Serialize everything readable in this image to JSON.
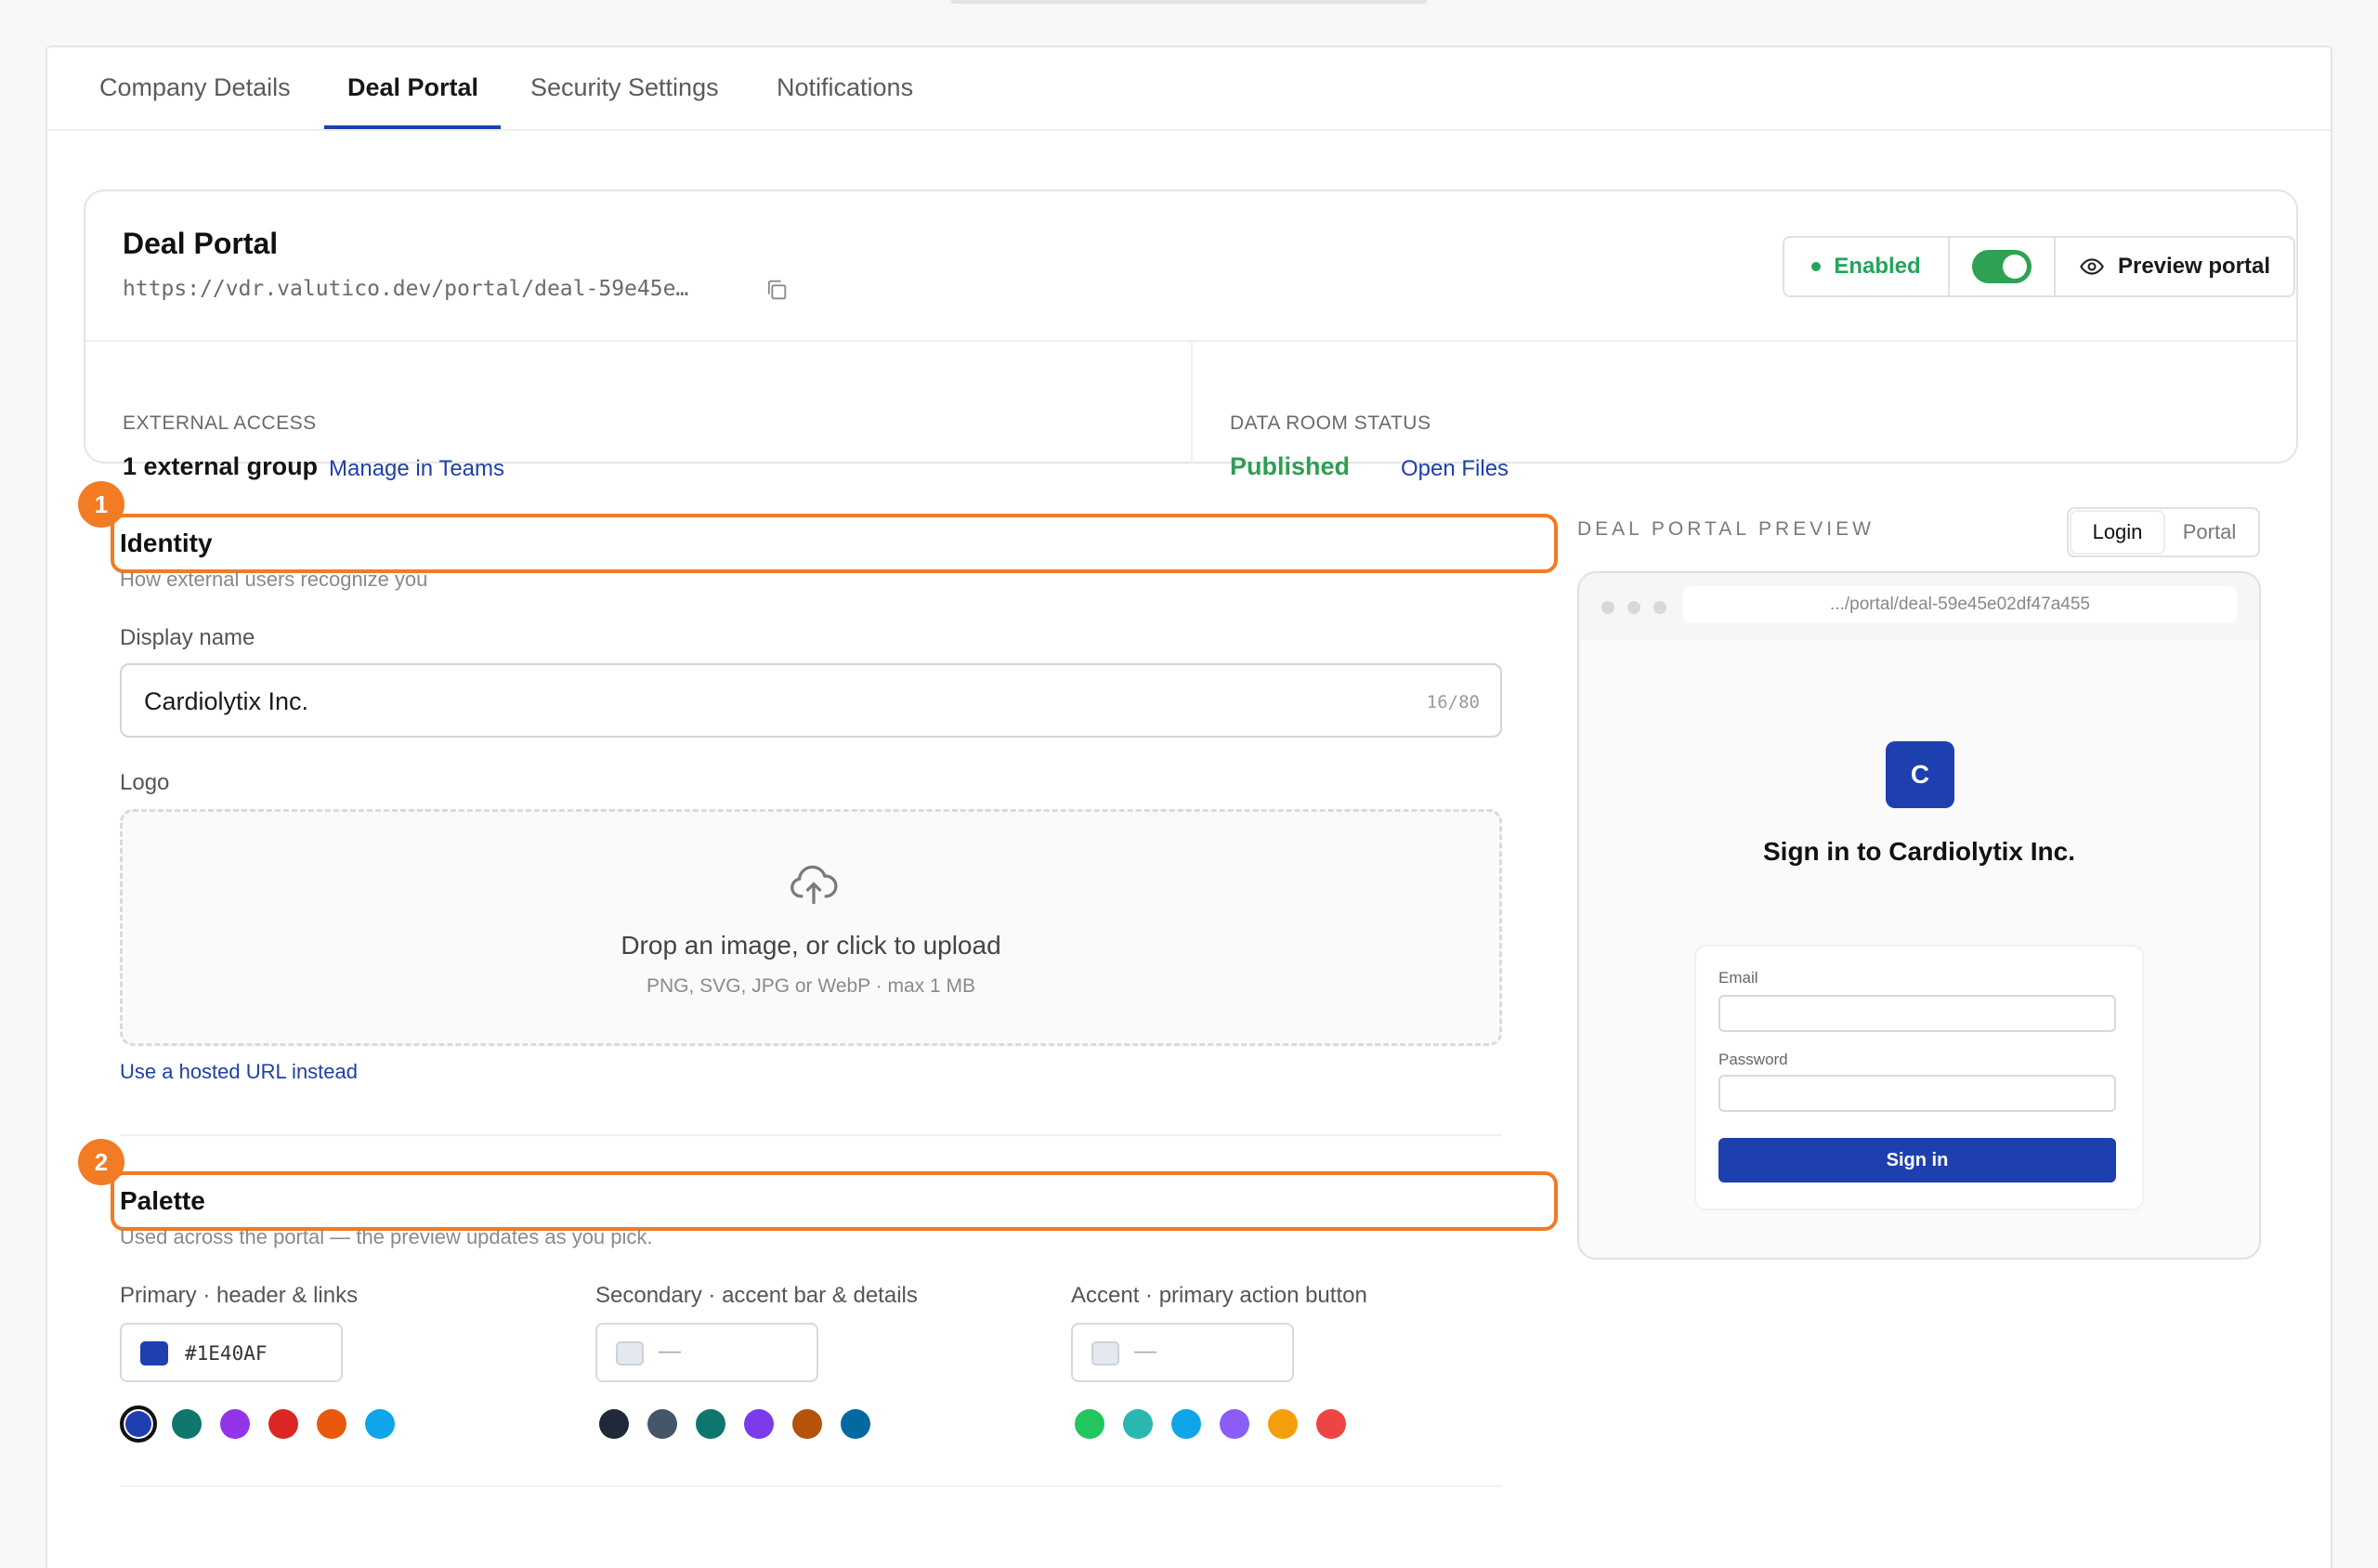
{
  "tabs": [
    {
      "label": "Company Details"
    },
    {
      "label": "Deal Portal"
    },
    {
      "label": "Security Settings"
    },
    {
      "label": "Notifications"
    }
  ],
  "active_tab": "Deal Portal",
  "portal": {
    "title": "Deal Portal",
    "url": "https://vdr.valutico.dev/portal/deal-59e45e…",
    "status": "Enabled",
    "toggle_on": true,
    "preview_label": "Preview portal",
    "external_access_label": "EXTERNAL ACCESS",
    "external_access_value": "1 external group",
    "external_access_link": "Manage in Teams",
    "data_room_label": "DATA ROOM STATUS",
    "data_room_value": "Published",
    "data_room_link": "Open Files"
  },
  "identity": {
    "badge": "1",
    "title": "Identity",
    "subtitle": "How external users recognize you",
    "display_name_label": "Display name",
    "display_name_value": "Cardiolytix Inc.",
    "display_name_count": "16/80",
    "logo_label": "Logo",
    "dropzone_main": "Drop an image, or click to upload",
    "dropzone_sub": "PNG, SVG, JPG or WebP · max 1 MB",
    "hosted_url_link": "Use a hosted URL instead"
  },
  "palette": {
    "badge": "2",
    "title": "Palette",
    "subtitle": "Used across the portal — the preview updates as you pick.",
    "groups": [
      {
        "label": "Primary · header & links",
        "value": "#1E40AF",
        "chip_color": "#1e40af",
        "swatches": [
          "#1e40af",
          "#0f766e",
          "#9333ea",
          "#dc2626",
          "#ea580c",
          "#0ea5e9"
        ],
        "selected_index": 0
      },
      {
        "label": "Secondary · accent bar & details",
        "value": "—",
        "chip_color": "",
        "swatches": [
          "#1f2937",
          "#475569",
          "#0f766e",
          "#7c3aed",
          "#b45309",
          "#0369a1"
        ],
        "selected_index": -1
      },
      {
        "label": "Accent · primary action button",
        "value": "—",
        "chip_color": "",
        "swatches": [
          "#22c55e",
          "#2ab7b0",
          "#0ea5e9",
          "#8b5cf6",
          "#f59e0b",
          "#ef4444"
        ],
        "selected_index": -1
      }
    ]
  },
  "preview": {
    "label": "DEAL PORTAL PREVIEW",
    "segments": [
      "Login",
      "Portal"
    ],
    "active_segment": "Login",
    "address": ".../portal/deal-59e45e02df47a455",
    "logo_letter": "C",
    "signin_title": "Sign in to Cardiolytix Inc.",
    "email_label": "Email",
    "password_label": "Password",
    "signin_button": "Sign in"
  },
  "colors": {
    "brand": "#1e40af",
    "highlight": "#f27b24",
    "success": "#22a55a"
  }
}
